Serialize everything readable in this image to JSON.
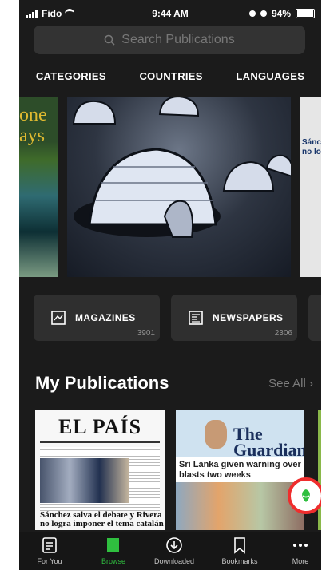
{
  "status": {
    "carrier": "Fido",
    "time": "9:44 AM",
    "battery": "94%"
  },
  "search": {
    "placeholder": "Search Publications"
  },
  "tabs": [
    "CATEGORIES",
    "COUNTRIES",
    "LANGUAGES"
  ],
  "featured": {
    "left_text": "one\nays",
    "right_text": "Sánch\nno log"
  },
  "categories": [
    {
      "label": "MAGAZINES",
      "count": "3901",
      "icon": "magazine-icon"
    },
    {
      "label": "NEWSPAPERS",
      "count": "2306",
      "icon": "newspaper-icon"
    }
  ],
  "my_publications": {
    "title": "My Publications",
    "see_all": "See All",
    "items": [
      {
        "masthead": "EL PAÍS",
        "headline": "Sánchez salva el debate y Rivera no logra imponer el tema catalán"
      },
      {
        "masthead": "The Guardian",
        "headline": "Sri Lanka given warning over blasts two weeks"
      }
    ]
  },
  "bottom_nav": [
    {
      "label": "For You",
      "icon": "for-you-icon"
    },
    {
      "label": "Browse",
      "icon": "browse-icon"
    },
    {
      "label": "Downloaded",
      "icon": "download-icon"
    },
    {
      "label": "Bookmarks",
      "icon": "bookmark-icon"
    },
    {
      "label": "More",
      "icon": "more-icon"
    }
  ],
  "colors": {
    "accent": "#2fbf3f",
    "highlight": "#ef2d2d",
    "background": "#1b1b1b"
  }
}
